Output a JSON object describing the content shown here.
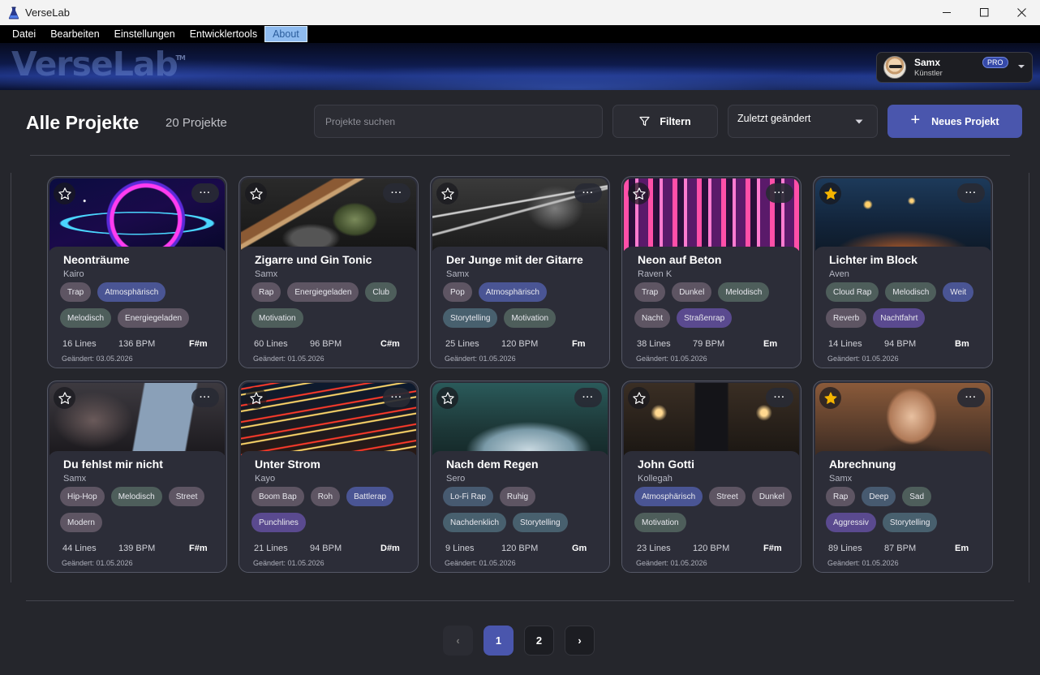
{
  "window": {
    "title": "VerseLab"
  },
  "menu": [
    "Datei",
    "Bearbeiten",
    "Einstellungen",
    "Entwicklertools",
    "About"
  ],
  "banner": {
    "logo": "VerseLab",
    "tm": "TM"
  },
  "user": {
    "name": "Samx",
    "role": "Künstler",
    "badge": "PRO"
  },
  "header": {
    "title": "Alle Projekte",
    "count": "20 Projekte",
    "search_placeholder": "Projekte suchen",
    "filter_label": "Filtern",
    "sort_label": "Zuletzt geändert",
    "new_label": "Neues Projekt"
  },
  "projects": [
    {
      "title": "Neonträume",
      "artist": "Kairo",
      "tags": [
        "Trap",
        "Atmosphärisch",
        "Melodisch",
        "Energiegeladen"
      ],
      "lines": "16 Lines",
      "bpm": "136 BPM",
      "key": "F#m",
      "date": "Geändert: 03.05.2026",
      "favorite": false
    },
    {
      "title": "Zigarre und Gin Tonic",
      "artist": "Samx",
      "tags": [
        "Rap",
        "Energiegeladen",
        "Club",
        "Motivation"
      ],
      "lines": "60 Lines",
      "bpm": "96 BPM",
      "key": "C#m",
      "date": "Geändert: 01.05.2026",
      "favorite": false
    },
    {
      "title": "Der Junge mit der Gitarre",
      "artist": "Samx",
      "tags": [
        "Pop",
        "Atmosphärisch",
        "Storytelling",
        "Motivation"
      ],
      "lines": "25 Lines",
      "bpm": "120 BPM",
      "key": "Fm",
      "date": "Geändert: 01.05.2026",
      "favorite": false
    },
    {
      "title": "Neon auf Beton",
      "artist": "Raven K",
      "tags": [
        "Trap",
        "Dunkel",
        "Melodisch",
        "Nacht",
        "Straßenrap"
      ],
      "lines": "38 Lines",
      "bpm": "79 BPM",
      "key": "Em",
      "date": "Geändert: 01.05.2026",
      "favorite": false
    },
    {
      "title": "Lichter im Block",
      "artist": "Aven",
      "tags": [
        "Cloud Rap",
        "Melodisch",
        "Weit",
        "Reverb",
        "Nachtfahrt"
      ],
      "lines": "14 Lines",
      "bpm": "94 BPM",
      "key": "Bm",
      "date": "Geändert: 01.05.2026",
      "favorite": true
    },
    {
      "title": "Du fehlst mir nicht",
      "artist": "Samx",
      "tags": [
        "Hip-Hop",
        "Melodisch",
        "Street",
        "Modern"
      ],
      "lines": "44 Lines",
      "bpm": "139 BPM",
      "key": "F#m",
      "date": "Geändert: 01.05.2026",
      "favorite": false
    },
    {
      "title": "Unter Strom",
      "artist": "Kayo",
      "tags": [
        "Boom Bap",
        "Roh",
        "Battlerap",
        "Punchlines"
      ],
      "lines": "21 Lines",
      "bpm": "94 BPM",
      "key": "D#m",
      "date": "Geändert: 01.05.2026",
      "favorite": false
    },
    {
      "title": "Nach dem Regen",
      "artist": "Sero",
      "tags": [
        "Lo-Fi Rap",
        "Ruhig",
        "Nachdenklich",
        "Storytelling"
      ],
      "lines": "9 Lines",
      "bpm": "120 BPM",
      "key": "Gm",
      "date": "Geändert: 01.05.2026",
      "favorite": false
    },
    {
      "title": "John Gotti",
      "artist": "Kollegah",
      "tags": [
        "Atmosphärisch",
        "Street",
        "Dunkel",
        "Motivation"
      ],
      "lines": "23 Lines",
      "bpm": "120 BPM",
      "key": "F#m",
      "date": "Geändert: 01.05.2026",
      "favorite": false
    },
    {
      "title": "Abrechnung",
      "artist": "Samx",
      "tags": [
        "Rap",
        "Deep",
        "Sad",
        "Aggressiv",
        "Storytelling"
      ],
      "lines": "89 Lines",
      "bpm": "87 BPM",
      "key": "Em",
      "date": "Geändert: 01.05.2026",
      "favorite": true
    }
  ],
  "pagination": {
    "prev": "‹",
    "pages": [
      "1",
      "2"
    ],
    "next": "›",
    "current": "1"
  }
}
